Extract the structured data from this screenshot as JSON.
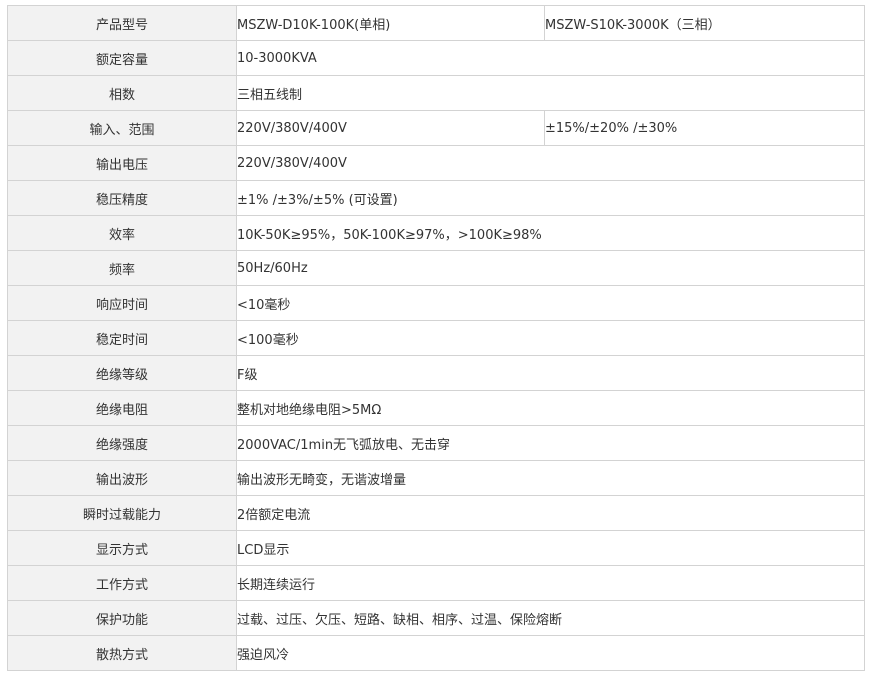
{
  "rows": [
    {
      "label": "产品型号",
      "values": [
        "MSZW-D10K-100K(单相)",
        "MSZW-S10K-3000K（三相）"
      ]
    },
    {
      "label": "额定容量",
      "values": [
        "10-3000KVA"
      ]
    },
    {
      "label": "相数",
      "values": [
        "三相五线制"
      ]
    },
    {
      "label": "输入、范围",
      "values": [
        "220V/380V/400V",
        "±15%/±20% /±30%"
      ]
    },
    {
      "label": "输出电压",
      "values": [
        "220V/380V/400V"
      ]
    },
    {
      "label": "稳压精度",
      "values": [
        "±1% /±3%/±5% (可设置)"
      ]
    },
    {
      "label": "效率",
      "values": [
        "10K-50K≥95%，50K-100K≥97%，>100K≥98%"
      ]
    },
    {
      "label": "频率",
      "values": [
        "50Hz/60Hz"
      ]
    },
    {
      "label": "响应时间",
      "values": [
        "<10毫秒"
      ]
    },
    {
      "label": "稳定时间",
      "values": [
        "<100毫秒"
      ]
    },
    {
      "label": "绝缘等级",
      "values": [
        "F级"
      ]
    },
    {
      "label": "绝缘电阻",
      "values": [
        "整机对地绝缘电阻>5MΩ"
      ]
    },
    {
      "label": "绝缘强度",
      "values": [
        "2000VAC/1min无飞弧放电、无击穿"
      ]
    },
    {
      "label": "输出波形",
      "values": [
        "输出波形无畸变，无谐波增量"
      ]
    },
    {
      "label": "瞬时过载能力",
      "values": [
        "2倍额定电流"
      ]
    },
    {
      "label": "显示方式",
      "values": [
        "LCD显示"
      ]
    },
    {
      "label": "工作方式",
      "values": [
        "长期连续运行"
      ]
    },
    {
      "label": "保护功能",
      "values": [
        "过载、过压、欠压、短路、缺相、相序、过温、保险熔断"
      ]
    },
    {
      "label": "散热方式",
      "values": [
        "强迫风冷"
      ]
    }
  ]
}
